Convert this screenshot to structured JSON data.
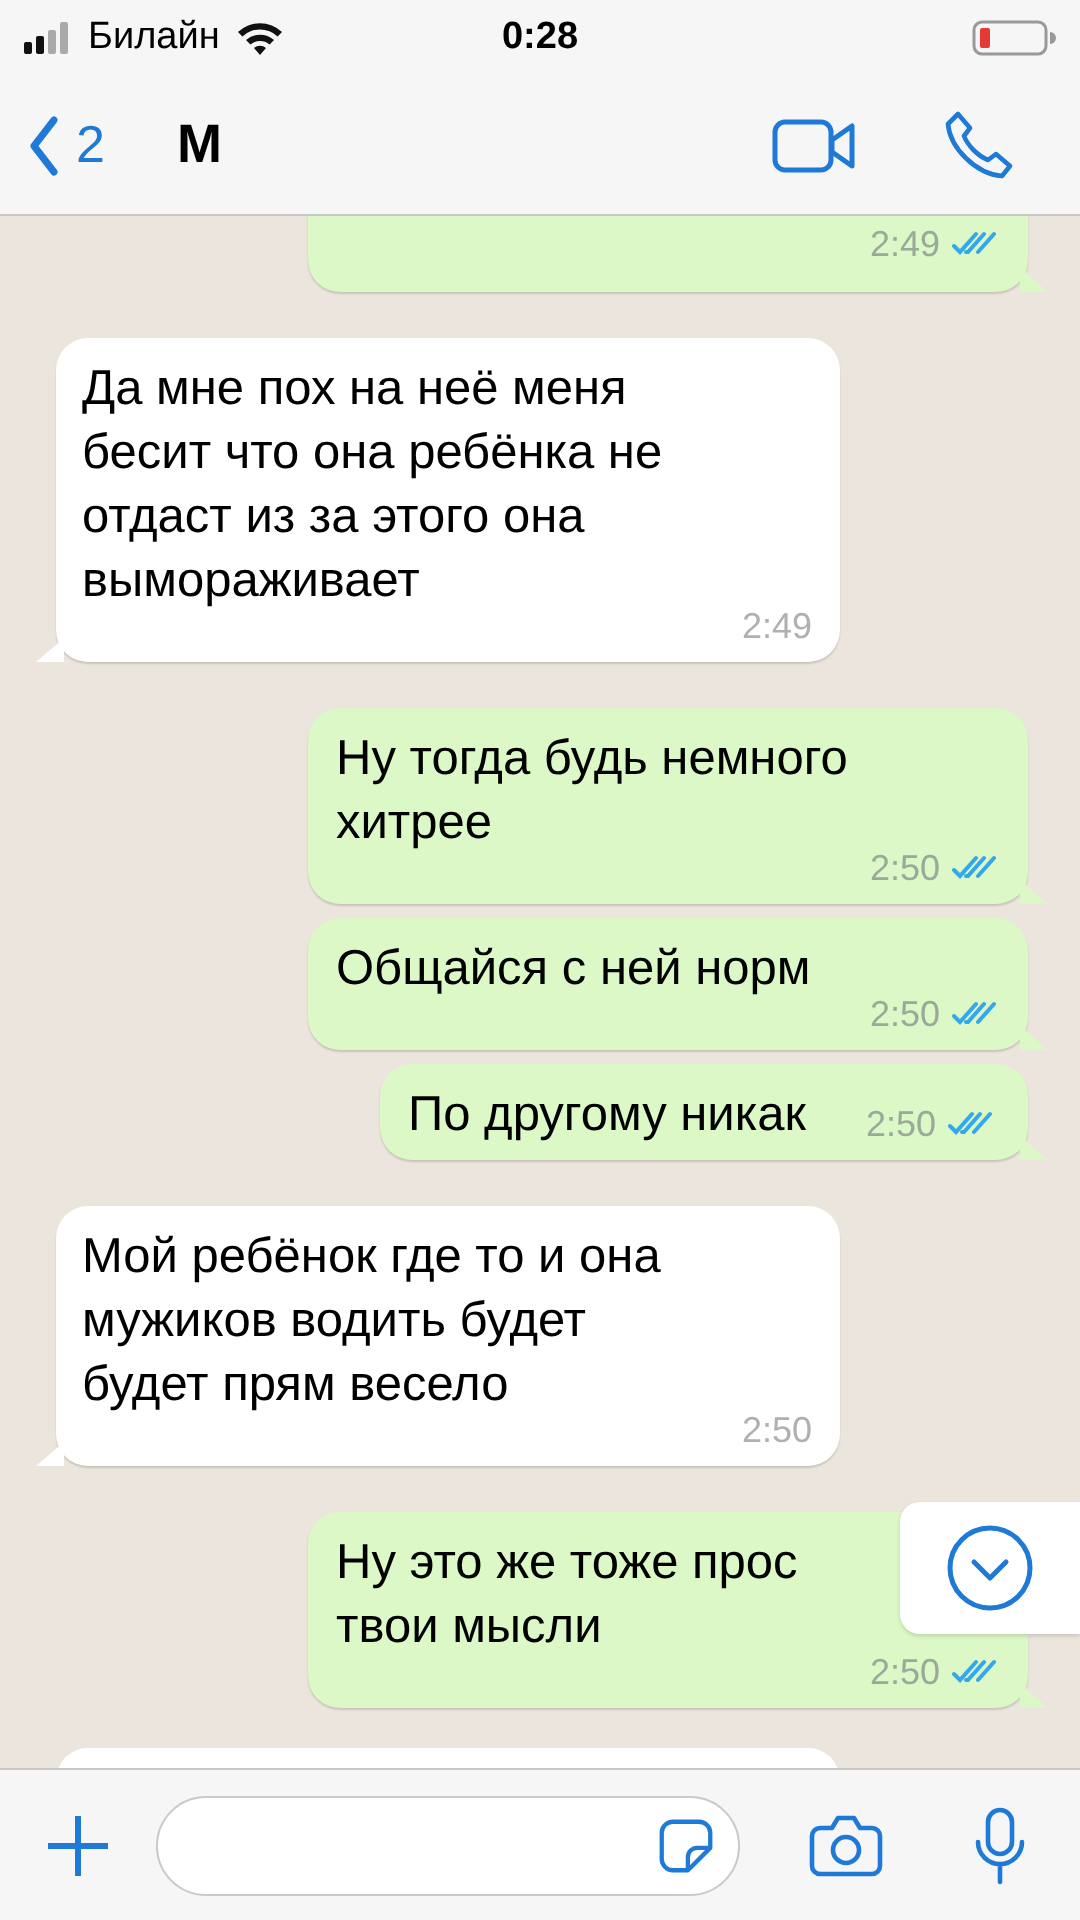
{
  "status_bar": {
    "carrier": "Билайн",
    "time": "0:28"
  },
  "header": {
    "back_count": "2",
    "title": "М"
  },
  "messages": [
    {
      "outgoing": true,
      "time": "2:49",
      "read": true,
      "cut_top": true
    },
    {
      "outgoing": false,
      "text": "Да мне пох на неё меня\nбесит что она ребёнка не\nотдаст из за этого она\nвымораживает",
      "time": "2:49"
    },
    {
      "outgoing": true,
      "text": "Ну тогда будь немного\nхитрее",
      "time": "2:50",
      "read": true
    },
    {
      "outgoing": true,
      "text": "Общайся с ней норм",
      "time": "2:50",
      "read": true
    },
    {
      "outgoing": true,
      "text": "По другому никак",
      "time": "2:50",
      "read": true,
      "inline_time": true
    },
    {
      "outgoing": false,
      "text": "Мой ребёнок где то и она\nмужиков водить будет\nбудет прям весело",
      "time": "2:50"
    },
    {
      "outgoing": true,
      "text": "Ну это же тоже прос\nтвои мысли",
      "time": "2:50",
      "read": true
    },
    {
      "outgoing": false,
      "cut_bottom": true
    }
  ]
}
